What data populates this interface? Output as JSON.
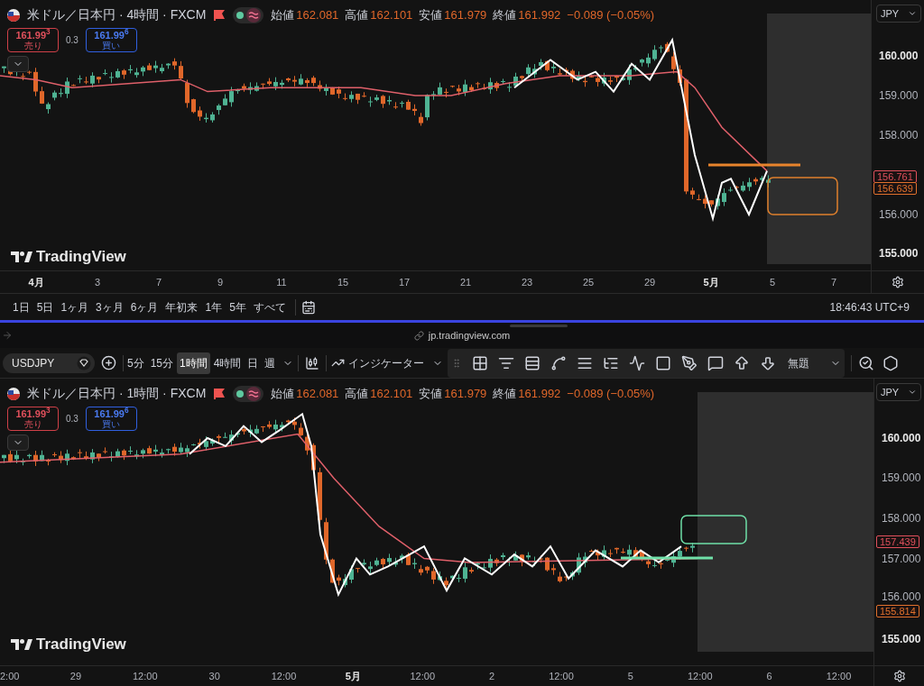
{
  "top_chart": {
    "title": "米ドル／日本円 · 4時間 · FXCM",
    "ohlc": [
      {
        "label": "始値",
        "value": "162.081"
      },
      {
        "label": "高値",
        "value": "162.101"
      },
      {
        "label": "安値",
        "value": "161.979"
      },
      {
        "label": "終値",
        "value": "161.992"
      }
    ],
    "change": "−0.089 (−0.05%)",
    "sell": {
      "price": "161.99$^{3}$",
      "label": "売り"
    },
    "spread": "0.3",
    "buy": {
      "price": "161.99$^{6}$",
      "label": "買い"
    },
    "logo": "TradingView",
    "currency": "JPY",
    "status_on": true,
    "price_ticks": [
      {
        "label": "160.000",
        "kind": "major"
      },
      {
        "label": "159.000",
        "kind": "minor"
      },
      {
        "label": "158.000",
        "kind": "minor"
      },
      {
        "label": "156.000",
        "kind": "minor"
      },
      {
        "label": "155.000",
        "kind": "major"
      }
    ],
    "price_badges": [
      {
        "label": "156.761",
        "color": "#e0505c"
      },
      {
        "label": "156.639",
        "color": "#e0702c"
      }
    ],
    "time_ticks": [
      {
        "label": "4月",
        "kind": "month"
      },
      {
        "label": "3",
        "kind": "day"
      },
      {
        "label": "7",
        "kind": "day"
      },
      {
        "label": "9",
        "kind": "day"
      },
      {
        "label": "11",
        "kind": "day"
      },
      {
        "label": "15",
        "kind": "day"
      },
      {
        "label": "17",
        "kind": "day"
      },
      {
        "label": "21",
        "kind": "day"
      },
      {
        "label": "23",
        "kind": "day"
      },
      {
        "label": "25",
        "kind": "day"
      },
      {
        "label": "29",
        "kind": "day"
      },
      {
        "label": "5月",
        "kind": "month"
      },
      {
        "label": "5",
        "kind": "day"
      },
      {
        "label": "7",
        "kind": "day"
      }
    ]
  },
  "range_bar": {
    "ranges": [
      "1日",
      "5日",
      "1ヶ月",
      "3ヶ月",
      "6ヶ月",
      "年初来",
      "1年",
      "5年",
      "すべて"
    ],
    "clock": "18:46:43 UTC+9"
  },
  "address_bar": {
    "url": "jp.tradingview.com"
  },
  "toolbar": {
    "symbol": "USDJPY",
    "intervals": [
      {
        "label": "5分",
        "selected": false
      },
      {
        "label": "15分",
        "selected": false
      },
      {
        "label": "1時間",
        "selected": true
      },
      {
        "label": "4時間",
        "selected": false
      },
      {
        "label": "日",
        "selected": false
      },
      {
        "label": "週",
        "selected": false
      }
    ],
    "indicators": "インジケーター",
    "layout_name": "無題"
  },
  "bottom_chart": {
    "title": "米ドル／日本円 · 1時間 · FXCM",
    "ohlc": [
      {
        "label": "始値",
        "value": "162.081"
      },
      {
        "label": "高値",
        "value": "162.101"
      },
      {
        "label": "安値",
        "value": "161.979"
      },
      {
        "label": "終値",
        "value": "161.992"
      }
    ],
    "change": "−0.089 (−0.05%)",
    "sell": {
      "price": "161.99$^{3}$",
      "label": "売り"
    },
    "spread": "0.3",
    "buy": {
      "price": "161.99$^{6}$",
      "label": "買い"
    },
    "logo": "TradingView",
    "currency": "JPY",
    "status_on": true,
    "price_ticks": [
      {
        "label": "160.000",
        "kind": "major"
      },
      {
        "label": "159.000",
        "kind": "minor"
      },
      {
        "label": "158.000",
        "kind": "minor"
      },
      {
        "label": "157.000",
        "kind": "minor"
      },
      {
        "label": "156.000",
        "kind": "minor"
      },
      {
        "label": "155.000",
        "kind": "major"
      }
    ],
    "price_badges": [
      {
        "label": "157.439",
        "color": "#e0505c"
      },
      {
        "label": "155.814",
        "color": "#e0702c"
      }
    ],
    "time_ticks": [
      {
        "label": "2:00",
        "kind": "day"
      },
      {
        "label": "29",
        "kind": "day"
      },
      {
        "label": "12:00",
        "kind": "day"
      },
      {
        "label": "30",
        "kind": "day"
      },
      {
        "label": "12:00",
        "kind": "day"
      },
      {
        "label": "5月",
        "kind": "month"
      },
      {
        "label": "12:00",
        "kind": "day"
      },
      {
        "label": "2",
        "kind": "day"
      },
      {
        "label": "12:00",
        "kind": "day"
      },
      {
        "label": "5",
        "kind": "day"
      },
      {
        "label": "12:00",
        "kind": "day"
      },
      {
        "label": "6",
        "kind": "day"
      },
      {
        "label": "12:00",
        "kind": "day"
      }
    ]
  }
}
